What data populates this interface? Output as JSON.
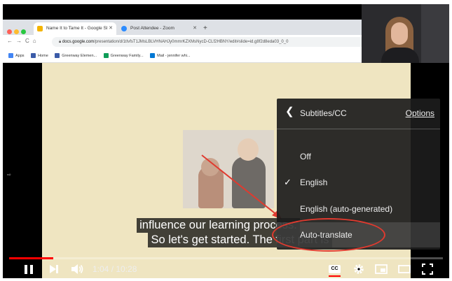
{
  "browser": {
    "tabs": [
      {
        "label": "Name It to Tame It - Google Sl",
        "favicon_color": "#f4b400"
      },
      {
        "label": "Post Attendee - Zoom",
        "favicon_color": "#2d8cff"
      }
    ],
    "url_host": "docs.google.com",
    "url_path": "/presentation/d/1tIvfsT1JMsLBLVHNAHJy0mmrKZXMsNycD-CLf2HBNY/edit#slide=id.g8f2d8eda03_0_0",
    "bookmarks": [
      {
        "label": "Apps",
        "color": "#4285f4"
      },
      {
        "label": "Home",
        "color": "#3b5ba8"
      },
      {
        "label": "Greenway Elemen...",
        "color": "#3b5ba8"
      },
      {
        "label": "Greenway Family...",
        "color": "#0f9d58"
      },
      {
        "label": "Mail - jennifer whi...",
        "color": "#0078d4"
      }
    ]
  },
  "captions": {
    "line1": "influence our learning process.",
    "line2": "So let's get started. The first part is"
  },
  "settings_menu": {
    "title": "Subtitles/CC",
    "options_link": "Options",
    "items": [
      {
        "label": "Off",
        "checked": false
      },
      {
        "label": "English",
        "checked": true
      },
      {
        "label": "English (auto-generated)",
        "checked": false
      },
      {
        "label": "Auto-translate",
        "checked": false,
        "highlighted": true
      }
    ]
  },
  "controls": {
    "current_time": "1:04",
    "duration": "10:28",
    "time_display": "1:04 / 10:28",
    "progress_fraction": 0.102,
    "cc_label": "CC"
  },
  "colors": {
    "progress": "#ff0000",
    "annotation": "#e03a2f",
    "slide_background": "#efe5c1"
  }
}
